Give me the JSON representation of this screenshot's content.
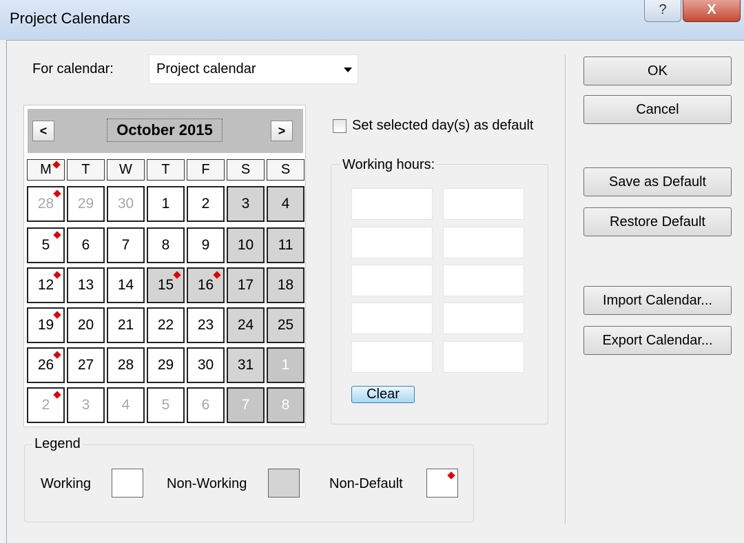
{
  "window": {
    "title": "Project Calendars",
    "help_glyph": "?",
    "close_glyph": "X"
  },
  "for_calendar": {
    "label": "For calendar:",
    "value": "Project calendar"
  },
  "calendar": {
    "month_label": "October 2015",
    "prev_glyph": "<",
    "next_glyph": ">",
    "weekdays": [
      "M",
      "T",
      "W",
      "T",
      "F",
      "S",
      "S"
    ],
    "weeks": [
      [
        {
          "d": "28",
          "s": "dim",
          "m": true
        },
        {
          "d": "29",
          "s": "dim"
        },
        {
          "d": "30",
          "s": "dim"
        },
        {
          "d": "1",
          "s": "working"
        },
        {
          "d": "2",
          "s": "working"
        },
        {
          "d": "3",
          "s": "nonworking"
        },
        {
          "d": "4",
          "s": "nonworking"
        }
      ],
      [
        {
          "d": "5",
          "s": "working",
          "m": true
        },
        {
          "d": "6",
          "s": "working"
        },
        {
          "d": "7",
          "s": "working"
        },
        {
          "d": "8",
          "s": "working"
        },
        {
          "d": "9",
          "s": "working"
        },
        {
          "d": "10",
          "s": "nonworking"
        },
        {
          "d": "11",
          "s": "nonworking"
        }
      ],
      [
        {
          "d": "12",
          "s": "working",
          "m": true
        },
        {
          "d": "13",
          "s": "working"
        },
        {
          "d": "14",
          "s": "working"
        },
        {
          "d": "15",
          "s": "nonworking",
          "m": true
        },
        {
          "d": "16",
          "s": "nonworking",
          "m": true
        },
        {
          "d": "17",
          "s": "nonworking"
        },
        {
          "d": "18",
          "s": "nonworking"
        }
      ],
      [
        {
          "d": "19",
          "s": "working",
          "m": true
        },
        {
          "d": "20",
          "s": "working"
        },
        {
          "d": "21",
          "s": "working"
        },
        {
          "d": "22",
          "s": "working"
        },
        {
          "d": "23",
          "s": "working"
        },
        {
          "d": "24",
          "s": "nonworking"
        },
        {
          "d": "25",
          "s": "nonworking"
        }
      ],
      [
        {
          "d": "26",
          "s": "working",
          "m": true
        },
        {
          "d": "27",
          "s": "working"
        },
        {
          "d": "28",
          "s": "working"
        },
        {
          "d": "29",
          "s": "working"
        },
        {
          "d": "30",
          "s": "working"
        },
        {
          "d": "31",
          "s": "nonworking"
        },
        {
          "d": "1",
          "s": "dark"
        }
      ],
      [
        {
          "d": "2",
          "s": "dim",
          "m": true
        },
        {
          "d": "3",
          "s": "dim"
        },
        {
          "d": "4",
          "s": "dim"
        },
        {
          "d": "5",
          "s": "dim"
        },
        {
          "d": "6",
          "s": "dim"
        },
        {
          "d": "7",
          "s": "dark"
        },
        {
          "d": "8",
          "s": "dark"
        }
      ]
    ]
  },
  "default_checkbox": {
    "label": "Set selected day(s) as default",
    "checked": false
  },
  "working_hours": {
    "caption": "Working hours:",
    "rows": [
      [
        "",
        ""
      ],
      [
        "",
        ""
      ],
      [
        "",
        ""
      ],
      [
        "",
        ""
      ],
      [
        "",
        ""
      ]
    ],
    "clear_label": "Clear"
  },
  "legend": {
    "caption": "Legend",
    "working": "Working",
    "non_working": "Non-Working",
    "non_default": "Non-Default"
  },
  "buttons": {
    "ok": "OK",
    "cancel": "Cancel",
    "save_default": "Save as Default",
    "restore_default": "Restore Default",
    "import": "Import Calendar...",
    "export": "Export Calendar..."
  },
  "colors": {
    "marker": "#e00000",
    "nonworking": "#d4d4d4",
    "header": "#bfbfbf"
  }
}
